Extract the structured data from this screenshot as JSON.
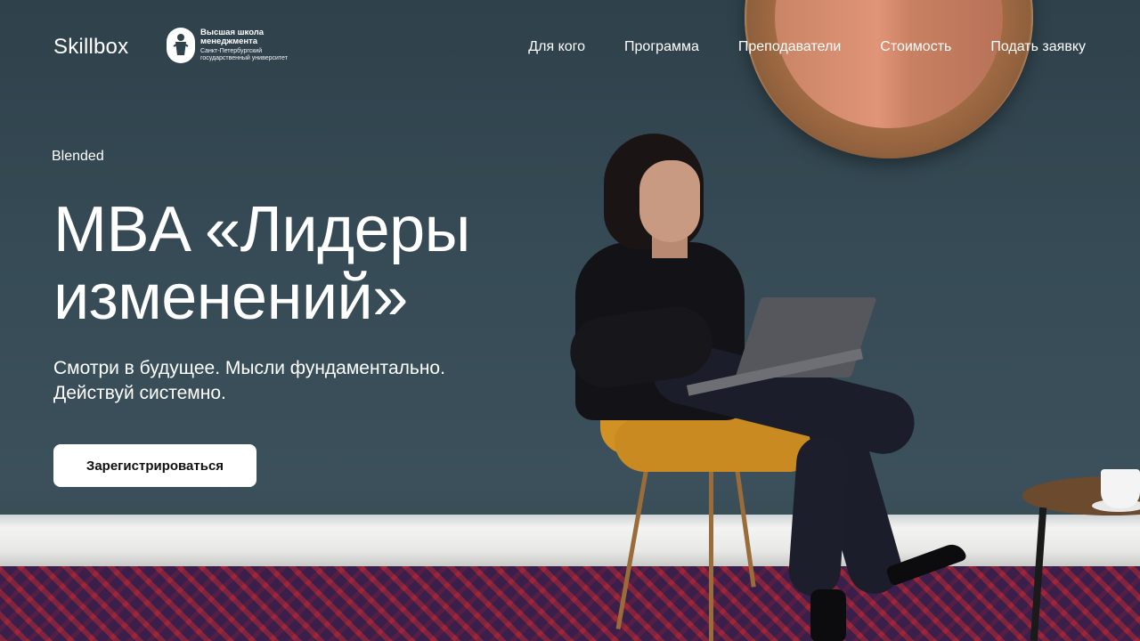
{
  "header": {
    "logo": "Skillbox",
    "partner": {
      "title_line1": "Высшая школа",
      "title_line2": "менеджмента",
      "sub_line1": "Санкт-Петербургский",
      "sub_line2": "государственный университет"
    },
    "nav": [
      {
        "label": "Для кого"
      },
      {
        "label": "Программа"
      },
      {
        "label": "Преподаватели"
      },
      {
        "label": "Стоимость"
      },
      {
        "label": "Подать заявку"
      }
    ]
  },
  "hero": {
    "eyebrow": "Blended",
    "title_line1": "MBA «Лидеры",
    "title_line2": "изменений»",
    "subtitle_line1": "Смотри в будущее. Мысли фундаментально.",
    "subtitle_line2": "Действуй системно.",
    "cta_label": "Зарегистрироваться"
  },
  "colors": {
    "wall": "#33454f",
    "text": "#ffffff",
    "button_bg": "#ffffff",
    "button_text": "#111111"
  }
}
